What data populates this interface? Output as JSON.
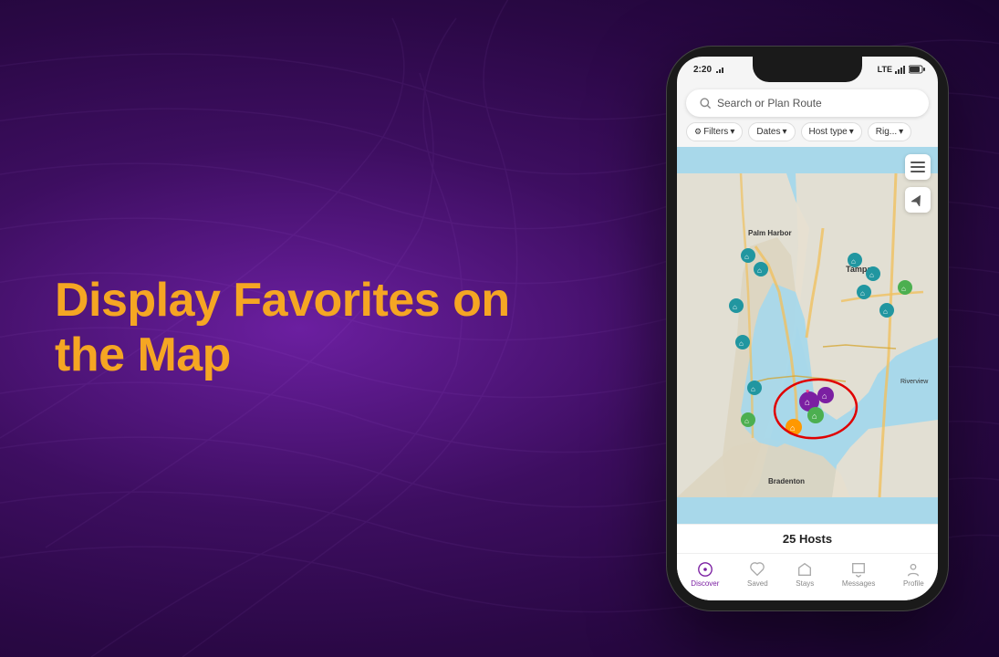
{
  "background": {
    "color_start": "#6b1fa0",
    "color_end": "#1a0530"
  },
  "headline": {
    "text": "Display Favorites on the Map"
  },
  "phone": {
    "status_bar": {
      "time": "2:20",
      "carrier": "LTE",
      "icons": [
        "signal",
        "wifi",
        "battery"
      ]
    },
    "search": {
      "placeholder": "Search or Plan Route"
    },
    "filters": [
      {
        "label": "Filters",
        "has_icon": true
      },
      {
        "label": "Dates",
        "has_dropdown": true
      },
      {
        "label": "Host type",
        "has_dropdown": true
      },
      {
        "label": "Rig...",
        "has_dropdown": true
      }
    ],
    "map": {
      "location": "Tampa Bay, Florida",
      "labels": [
        "Palm Harbor",
        "Tampa",
        "Bradenton",
        "Riverview"
      ]
    },
    "hosts_count": "25 Hosts",
    "nav": [
      {
        "label": "Discover",
        "active": true
      },
      {
        "label": "Saved",
        "active": false
      },
      {
        "label": "Stays",
        "active": false
      },
      {
        "label": "Messages",
        "active": false
      },
      {
        "label": "Profile",
        "active": false
      }
    ]
  }
}
